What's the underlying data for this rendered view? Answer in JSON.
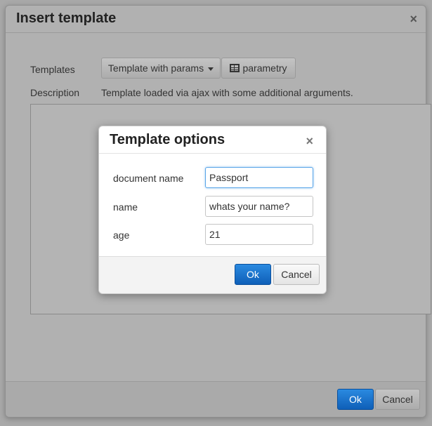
{
  "insert_dialog": {
    "title": "Insert template",
    "close_glyph": "×",
    "templates_label": "Templates",
    "template_select_value": "Template with params",
    "params_button_label": "parametry",
    "description_label": "Description",
    "description_text": "Template loaded via ajax with some additional arguments.",
    "ok_label": "Ok",
    "cancel_label": "Cancel"
  },
  "options_dialog": {
    "title": "Template options",
    "close_glyph": "×",
    "fields": [
      {
        "label": "document name",
        "value": "Passport",
        "focused": true
      },
      {
        "label": "name",
        "value": "whats your name?"
      },
      {
        "label": "age",
        "value": "21"
      }
    ],
    "ok_label": "Ok",
    "cancel_label": "Cancel"
  },
  "colors": {
    "primary": "#1a72cf",
    "focus_border": "#59a5e8",
    "overlay": "#a9a9a9"
  },
  "icons": {
    "close": "close-icon",
    "dropdown": "caret-down-icon",
    "params": "table-icon"
  }
}
